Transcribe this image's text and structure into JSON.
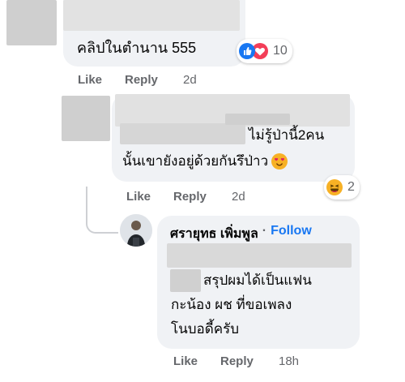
{
  "comment1": {
    "text": "คลิปในตำนาน 555",
    "reaction_count": "10",
    "like_label": "Like",
    "reply_label": "Reply",
    "age": "2d"
  },
  "comment2": {
    "text_line1": "ไม่รู้ป่านี้2คน",
    "text_line2": "นั้นเขายังอยู่ด้วยกันรึป่าว",
    "reaction_count": "2",
    "like_label": "Like",
    "reply_label": "Reply",
    "age": "2d"
  },
  "comment3": {
    "author": "ศรายุทธ เพิ่มพูล",
    "separator": "·",
    "follow_label": "Follow",
    "text_line1": "สรุปผมได้เป็นแฟน",
    "text_line2": "กะน้อง ผช ที่ขอเพลง",
    "text_line3": "โนบอดี้ครับ",
    "like_label": "Like",
    "reply_label": "Reply",
    "age": "18h"
  },
  "colors": {
    "bubble": "#f0f2f5",
    "action_text": "#65676b",
    "link_blue": "#1877f2",
    "like_blue": "#1877f2",
    "love_red": "#f33e58",
    "haha_yellow": "#f7b125"
  },
  "icons": [
    "like-reaction-icon",
    "love-reaction-icon",
    "haha-reaction-icon",
    "in-love-emoji-icon"
  ]
}
